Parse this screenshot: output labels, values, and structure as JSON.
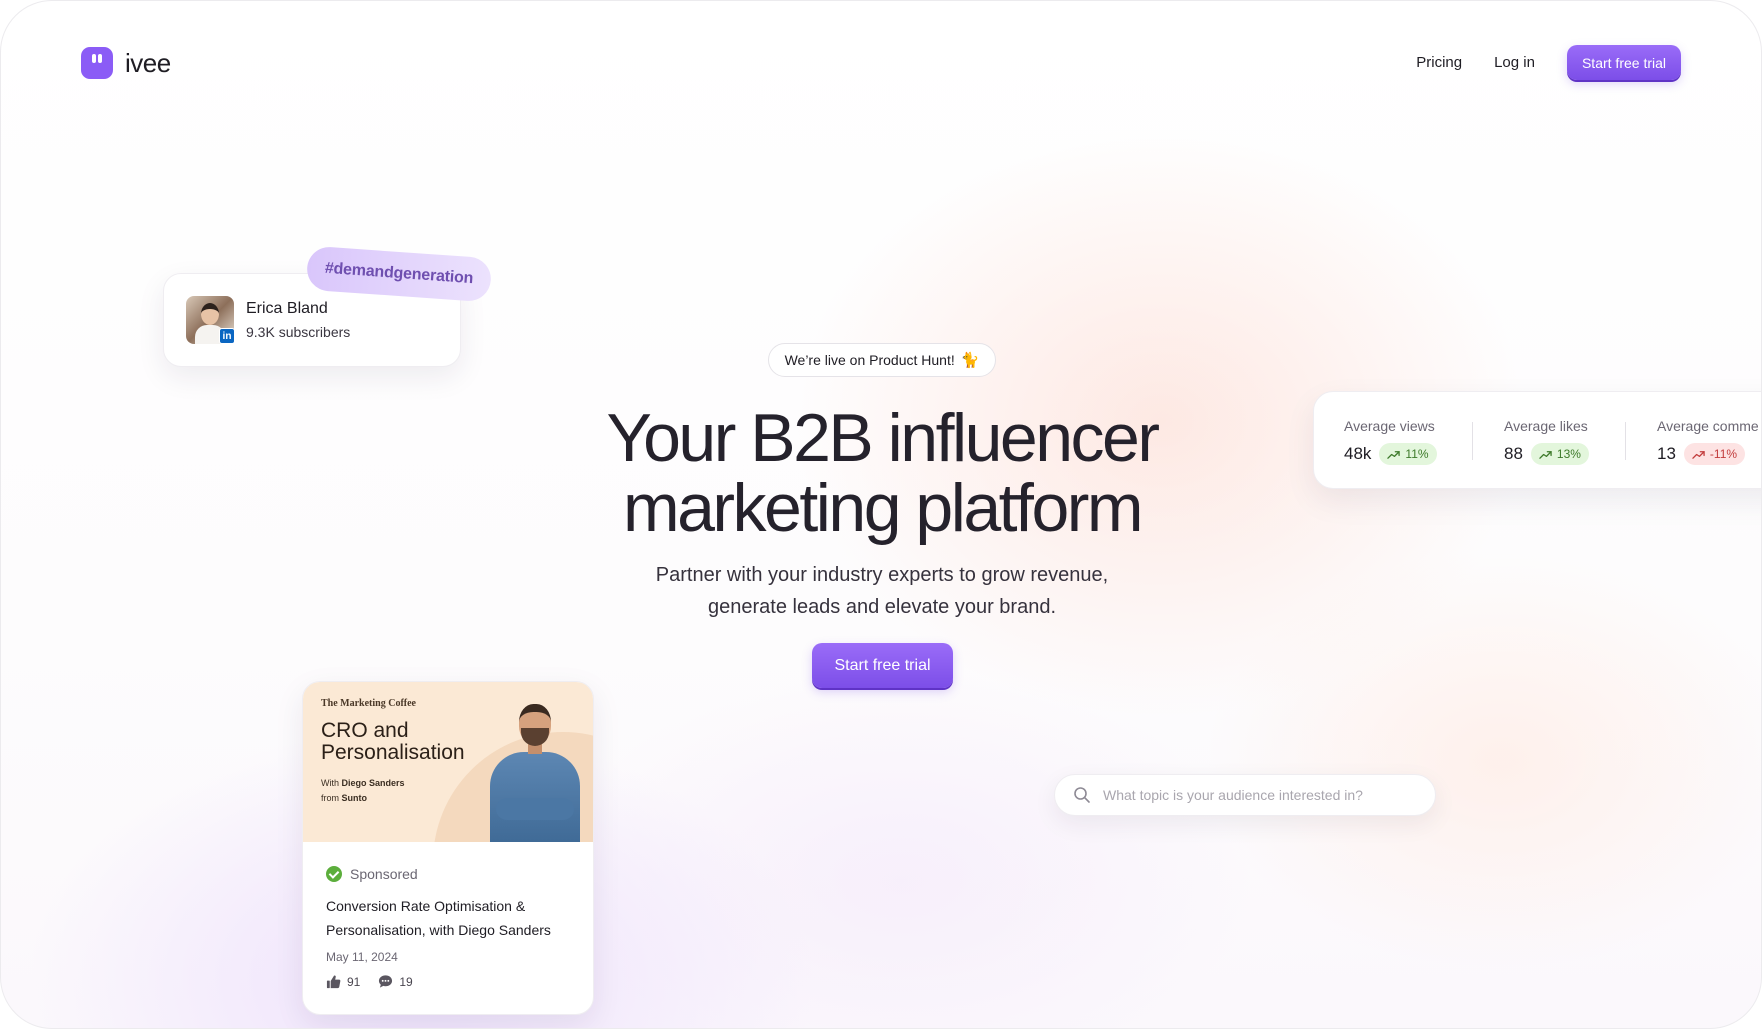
{
  "header": {
    "logo_text": "ivee",
    "nav": {
      "pricing": "Pricing",
      "login": "Log in",
      "cta": "Start free trial"
    }
  },
  "hero": {
    "badge": "We’re live on Product Hunt!",
    "badge_emoji": "🐈",
    "title_line1": "Your B2B influencer",
    "title_line2": "marketing platform",
    "subtitle_line1": "Partner with your industry experts to grow revenue,",
    "subtitle_line2": "generate leads and elevate your brand.",
    "cta": "Start free trial"
  },
  "profile_card": {
    "name": "Erica Bland",
    "subscribers": "9.3K subscribers",
    "network_badge": "in",
    "hashtag": "#demandgeneration"
  },
  "stats": [
    {
      "label": "Average views",
      "value": "48k",
      "change": "11%",
      "trend": "up"
    },
    {
      "label": "Average likes",
      "value": "88",
      "change": "13%",
      "trend": "up"
    },
    {
      "label": "Average comme",
      "value": "13",
      "change": "-11%",
      "trend": "down"
    }
  ],
  "search": {
    "placeholder": "What topic is your audience interested in?"
  },
  "post_card": {
    "thumb_brand": "The Marketing Coffee",
    "thumb_title": "CRO and Personalisation",
    "thumb_with_prefix": "With",
    "thumb_with_name": "Diego Sanders",
    "thumb_from_prefix": "from",
    "thumb_from_company": "Sunto",
    "sponsored": "Sponsored",
    "title": "Conversion Rate Optimisation & Personalisation, with Diego Sanders",
    "date": "May 11, 2024",
    "likes": "91",
    "comments": "19"
  },
  "colors": {
    "brand": "#8b5cf6",
    "positive": "#3d7a2a",
    "negative": "#c23c3c"
  }
}
